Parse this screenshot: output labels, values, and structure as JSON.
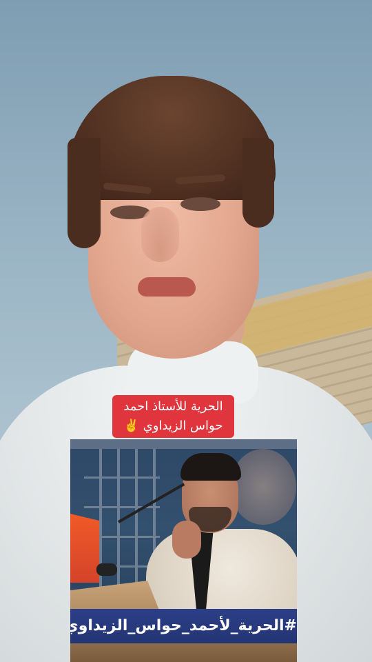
{
  "caption": {
    "line1": "الحرية للأستاذ احمد",
    "line2": "حواس الزيداوي ✌️"
  },
  "inset": {
    "hashtag": "#الحرية_لأحمد_حواس_الزيداوي"
  },
  "colors": {
    "caption_bg": "#e0353c",
    "banner_bg": "#2c3e86"
  }
}
